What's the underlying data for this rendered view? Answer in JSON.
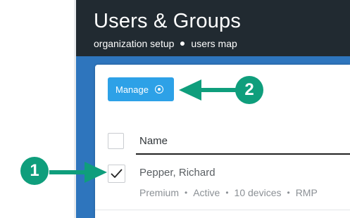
{
  "header": {
    "title": "Users & Groups",
    "breadcrumb": [
      "organization setup",
      "users map"
    ]
  },
  "toolbar": {
    "manage_label": "Manage",
    "manage_icon": "target-icon"
  },
  "table": {
    "columns": [
      "Name"
    ],
    "rows": [
      {
        "checked": true,
        "name": "Pepper, Richard",
        "details": [
          "Premium",
          "Active",
          "10 devices",
          "RMP"
        ]
      }
    ]
  },
  "callouts": [
    {
      "number": "1",
      "points_to": "row checkbox"
    },
    {
      "number": "2",
      "points_to": "Manage button"
    }
  ],
  "colors": {
    "header_bg": "#212a31",
    "band_bg": "#2e75bd",
    "button_bg": "#2da1e7",
    "callout": "#0f9e7c"
  }
}
